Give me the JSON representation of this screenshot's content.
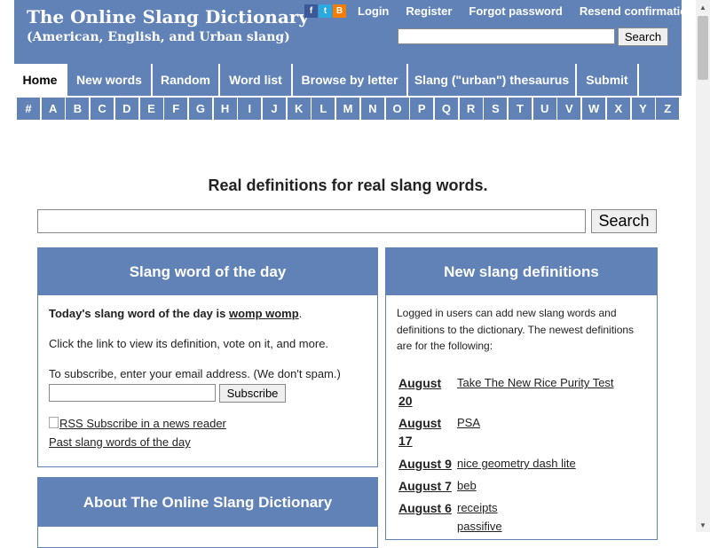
{
  "header": {
    "title": "The Online Slang Dictionary",
    "subtitle": "(American, English, and Urban slang)",
    "social_icons": [
      "facebook-icon",
      "twitter-icon",
      "blogger-icon"
    ],
    "links": [
      "Login",
      "Register",
      "Forgot password",
      "Resend confirmation"
    ],
    "search_button": "Search"
  },
  "nav": {
    "tabs": [
      "Home",
      "New words",
      "Random",
      "Word list",
      "Browse by letter",
      "Slang (\"urban\") thesaurus",
      "Submit"
    ],
    "active_tab": "Home",
    "letters": [
      "#",
      "A",
      "B",
      "C",
      "D",
      "E",
      "F",
      "G",
      "H",
      "I",
      "J",
      "K",
      "L",
      "M",
      "N",
      "O",
      "P",
      "Q",
      "R",
      "S",
      "T",
      "U",
      "V",
      "W",
      "X",
      "Y",
      "Z"
    ]
  },
  "main": {
    "tagline": "Real definitions for real slang words.",
    "search_button": "Search"
  },
  "word_of_day": {
    "heading": "Slang word of the day",
    "intro": "Today's slang word of the day is ",
    "word": "womp womp",
    "period": ".",
    "click_text": "Click the link to view its definition, vote on it, and more.",
    "subscribe_prompt": "To subscribe, enter your email address. (We don't spam.)",
    "subscribe_button": "Subscribe",
    "rss_text": "RSS Subscribe in a news reader",
    "past_link": "Past slang words of the day"
  },
  "new_definitions": {
    "heading": "New slang definitions",
    "intro_lines": [
      "Logged in users can add new slang words and",
      "definitions to the dictionary. The newest definitions",
      "are for the following:"
    ],
    "entries": [
      {
        "date": "August 20",
        "words": [
          "Take The New Rice Purity Test"
        ]
      },
      {
        "date": "August 17",
        "words": [
          "PSA"
        ]
      },
      {
        "date": "August 9",
        "words": [
          "nice geometry dash lite"
        ]
      },
      {
        "date": "August 7",
        "words": [
          "beb"
        ]
      },
      {
        "date": "August 6",
        "words": [
          "receipts",
          "passifive"
        ]
      }
    ]
  },
  "about": {
    "heading": "About The Online Slang Dictionary"
  },
  "colors": {
    "brand": "#6082b6",
    "text": "#222222"
  }
}
